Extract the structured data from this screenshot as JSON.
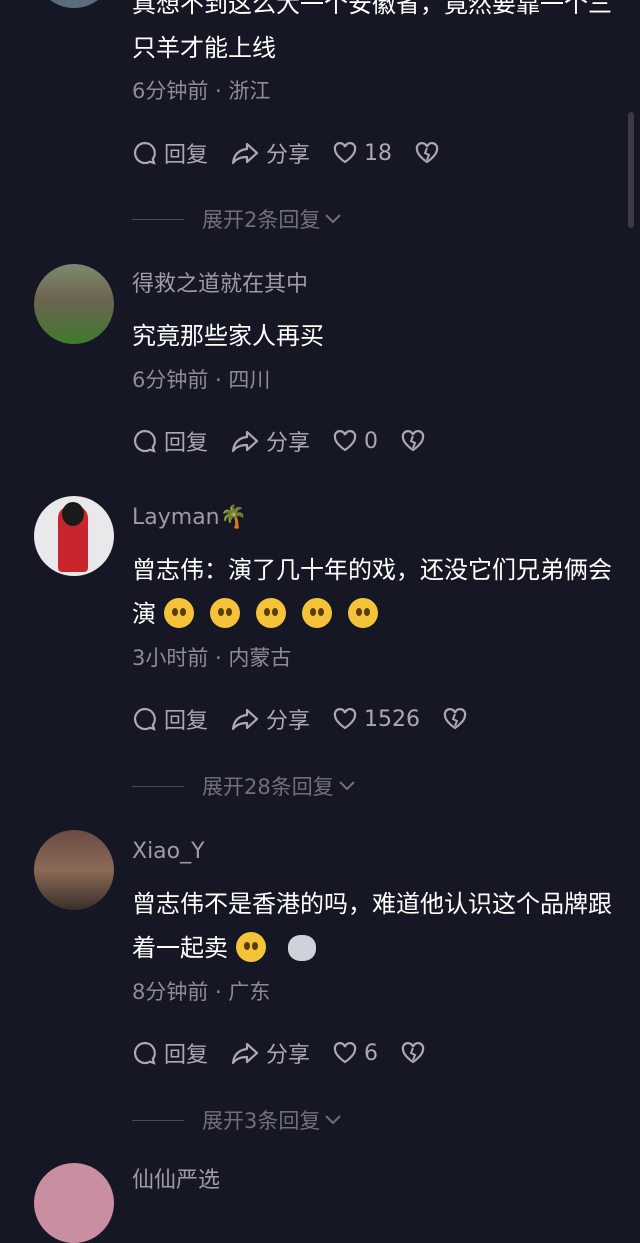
{
  "comments": [
    {
      "username": "",
      "text": "真想不到这么大一个安徽省，竟然要靠一个三只羊才能上线",
      "time_location": "6分钟前 · 浙江",
      "reply_label": "回复",
      "share_label": "分享",
      "likes": "18",
      "expand_label": "展开2条回复"
    },
    {
      "username": "得救之道就在其中",
      "text": "究竟那些家人再买",
      "time_location": "6分钟前 · 四川",
      "reply_label": "回复",
      "share_label": "分享",
      "likes": "0"
    },
    {
      "username": "Layman🌴",
      "text": "曾志伟：演了几十年的戏，还没它们兄弟俩会演",
      "time_location": "3小时前 · 内蒙古",
      "reply_label": "回复",
      "share_label": "分享",
      "likes": "1526",
      "expand_label": "展开28条回复"
    },
    {
      "username": "Xiao_Y",
      "text": "曾志伟不是香港的吗，难道他认识这个品牌跟着一起卖",
      "time_location": "8分钟前 · 广东",
      "reply_label": "回复",
      "share_label": "分享",
      "likes": "6",
      "expand_label": "展开3条回复"
    },
    {
      "username": "仙仙严选"
    }
  ],
  "icons": {
    "reply": "reply-bubble-icon",
    "share": "share-arrow-icon",
    "like": "heart-icon",
    "dislike": "broken-heart-icon",
    "expand": "chevron-down-icon"
  },
  "colors": {
    "background": "#161724",
    "text_primary": "#ffffff",
    "text_secondary": "#8b8c95"
  }
}
